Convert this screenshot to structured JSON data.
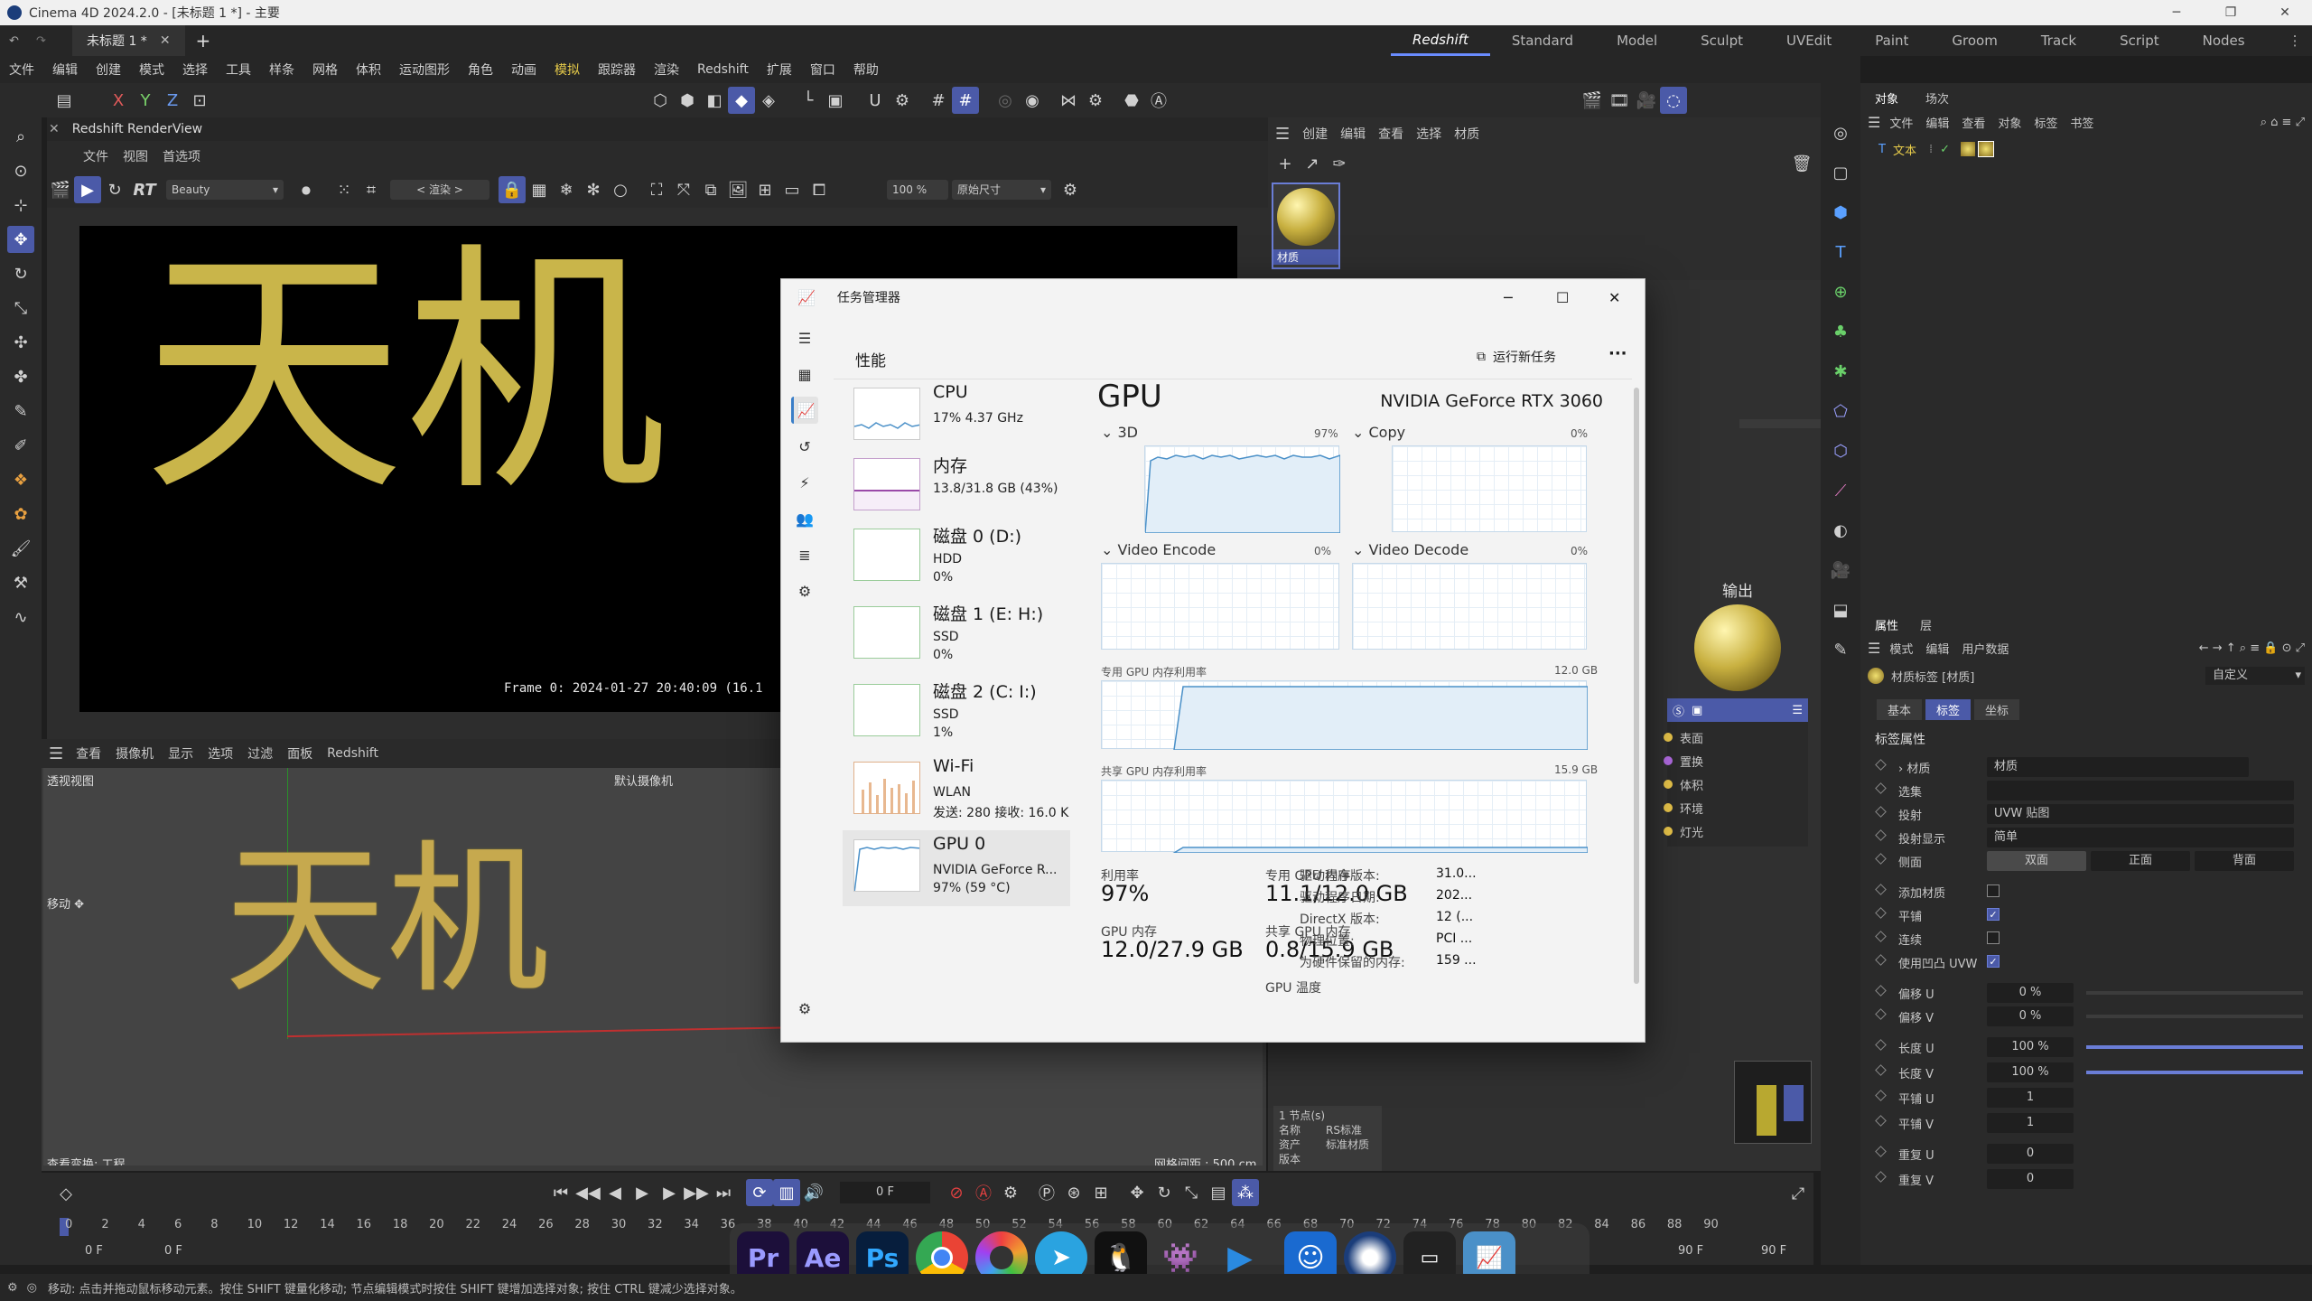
{
  "window": {
    "title": "Cinema 4D 2024.2.0 - [未标题 1 *] - 主要",
    "doc_tab": "未标题 1 *",
    "layouts": [
      "Redshift",
      "Standard",
      "Model",
      "Sculpt",
      "UVEdit",
      "Paint",
      "Groom",
      "Track",
      "Script",
      "Nodes"
    ]
  },
  "menubar": [
    "文件",
    "编辑",
    "创建",
    "模式",
    "选择",
    "工具",
    "样条",
    "网格",
    "体积",
    "运动图形",
    "角色",
    "动画",
    "模拟",
    "跟踪器",
    "渲染",
    "Redshift",
    "扩展",
    "窗口",
    "帮助"
  ],
  "axis_toolbar": {
    "x": "X",
    "y": "Y",
    "z": "Z"
  },
  "renderview": {
    "title": "Redshift RenderView",
    "menu": [
      "文件",
      "视图",
      "首选项"
    ],
    "rt": "RT",
    "aov": "Beauty",
    "render_btn": "< 渲染 >",
    "zoom": "100 %",
    "size": "原始尺寸",
    "frame_info": "Frame  0:  2024-01-27   20:40:09   (16.1",
    "text": "天机"
  },
  "viewport": {
    "menu": [
      "查看",
      "摄像机",
      "显示",
      "选项",
      "过滤",
      "面板",
      "Redshift"
    ],
    "label": "透视视图",
    "camera": "默认摄像机",
    "move_label": "移动",
    "grid": "网格间距 : 500 cm",
    "view_transform": "查看变换: 工程",
    "text": "天机"
  },
  "timeline": {
    "current_frame": "0 F",
    "ticks": [
      "0",
      "2",
      "4",
      "6",
      "8",
      "10",
      "12",
      "14",
      "16",
      "18",
      "20",
      "22",
      "24",
      "26",
      "28",
      "30",
      "32",
      "34",
      "36",
      "38",
      "40",
      "42",
      "44",
      "46",
      "48",
      "50",
      "52",
      "54",
      "56",
      "58",
      "60",
      "62",
      "64",
      "66",
      "68",
      "70",
      "72",
      "74",
      "76",
      "78",
      "80",
      "82",
      "84",
      "86",
      "88",
      "90"
    ],
    "start_a": "0 F",
    "start_b": "0 F",
    "end_a": "90 F",
    "end_b": "90 F"
  },
  "material": {
    "menu": [
      "创建",
      "编辑",
      "查看",
      "选择",
      "材质"
    ],
    "swatch_label": "材质",
    "output_label": "输出",
    "ports": [
      "表面",
      "置换",
      "体积",
      "环境",
      "灯光"
    ],
    "node_info": {
      "line1": "1 节点(s)",
      "k_name": "名称",
      "v_name": "RS标准",
      "k_asset": "资产",
      "v_asset": "标准材质",
      "k_ver": "版本"
    }
  },
  "objects": {
    "tabs": [
      "对象",
      "场次"
    ],
    "menu": [
      "文件",
      "编辑",
      "查看",
      "对象",
      "标签",
      "书签"
    ],
    "item": "文本"
  },
  "attributes": {
    "tabs": [
      "属性",
      "层"
    ],
    "menu": [
      "模式",
      "编辑",
      "用户数据"
    ],
    "title": "材质标签 [材质]",
    "mode": "自定义",
    "subtabs": [
      "基本",
      "标签",
      "坐标"
    ],
    "section": "标签属性",
    "rows": {
      "material": {
        "label": "材质",
        "value": "材质"
      },
      "selection": {
        "label": "选集",
        "value": ""
      },
      "projection": {
        "label": "投射",
        "value": "UVW 贴图"
      },
      "projection_display": {
        "label": "投射显示",
        "value": "简单"
      },
      "side": {
        "label": "侧面",
        "opt1": "双面",
        "opt2": "正面",
        "opt3": "背面"
      },
      "add_material": {
        "label": "添加材质"
      },
      "tile": {
        "label": "平铺"
      },
      "seamless": {
        "label": "连续"
      },
      "use_uvw": {
        "label": "使用凹凸 UVW"
      },
      "offset_u": {
        "label": "偏移 U",
        "value": "0 %",
        "fraction": 0
      },
      "offset_v": {
        "label": "偏移 V",
        "value": "0 %",
        "fraction": 0
      },
      "length_u": {
        "label": "长度 U",
        "value": "100 %",
        "fraction": 1
      },
      "length_v": {
        "label": "长度 V",
        "value": "100 %",
        "fraction": 1
      },
      "tiles_u": {
        "label": "平铺 U",
        "value": "1"
      },
      "tiles_v": {
        "label": "平铺 V",
        "value": "1"
      },
      "repeat_u": {
        "label": "重复 U",
        "value": "0"
      },
      "repeat_v": {
        "label": "重复 V",
        "value": "0"
      }
    }
  },
  "taskmgr": {
    "title": "任务管理器",
    "section": "性能",
    "run_task": "运行新任务",
    "more": "···",
    "items": [
      {
        "name": "CPU",
        "l2": "17%  4.37 GHz",
        "l3": ""
      },
      {
        "name": "内存",
        "l2": "13.8/31.8 GB (43%)",
        "l3": ""
      },
      {
        "name": "磁盘 0 (D:)",
        "l2": "HDD",
        "l3": "0%"
      },
      {
        "name": "磁盘 1 (E: H:)",
        "l2": "SSD",
        "l3": "0%"
      },
      {
        "name": "磁盘 2 (C: I:)",
        "l2": "SSD",
        "l3": "1%"
      },
      {
        "name": "Wi-Fi",
        "l2": "WLAN",
        "l3": "发送: 280  接收: 16.0 K"
      },
      {
        "name": "GPU 0",
        "l2": "NVIDIA GeForce R...",
        "l3": "97% (59 °C)"
      }
    ],
    "gpu": {
      "heading": "GPU",
      "model": "NVIDIA GeForce RTX 3060",
      "g3d": {
        "label": "3D",
        "pct": "97%"
      },
      "gcopy": {
        "label": "Copy",
        "pct": "0%"
      },
      "genc": {
        "label": "Video Encode",
        "pct": "0%"
      },
      "gdec": {
        "label": "Video Decode",
        "pct": "0%"
      },
      "dedicated": {
        "label": "专用 GPU 内存利用率",
        "max": "12.0 GB"
      },
      "shared": {
        "label": "共享 GPU 内存利用率",
        "max": "15.9 GB"
      },
      "util_label": "利用率",
      "util": "97%",
      "ded_label": "专用 GPU 内存",
      "ded": "11.1/12.0 GB",
      "mem_label": "GPU 内存",
      "mem": "12.0/27.9 GB",
      "shr_label": "共享 GPU 内存",
      "shr": "0.8/15.9 GB",
      "temp_label": "GPU 温度",
      "kv": [
        {
          "k": "驱动程序版本:",
          "v": "31.0..."
        },
        {
          "k": "驱动程序日期:",
          "v": "202..."
        },
        {
          "k": "DirectX 版本:",
          "v": "12 (..."
        },
        {
          "k": "物理位置:",
          "v": "PCI ..."
        },
        {
          "k": "为硬件保留的内存:",
          "v": "159 ..."
        }
      ]
    }
  },
  "dock": [
    {
      "label": "Pr",
      "bg": "#1c0f3a",
      "fg": "#9a9aff"
    },
    {
      "label": "Ae",
      "bg": "#1c0f3a",
      "fg": "#9a9aff"
    },
    {
      "label": "Ps",
      "bg": "#071e3d",
      "fg": "#31a8ff"
    }
  ],
  "statusbar": "移动: 点击并拖动鼠标移动元素。按住 SHIFT 键量化移动; 节点编辑模式时按住 SHIFT 键增加选择对象; 按住 CTRL 键减少选择对象。",
  "colors": {
    "accent": "#4b5aa8",
    "gold": "#c9b54a",
    "highlight_menu": "#e8cc4a",
    "graph_line": "#4a90c8"
  }
}
